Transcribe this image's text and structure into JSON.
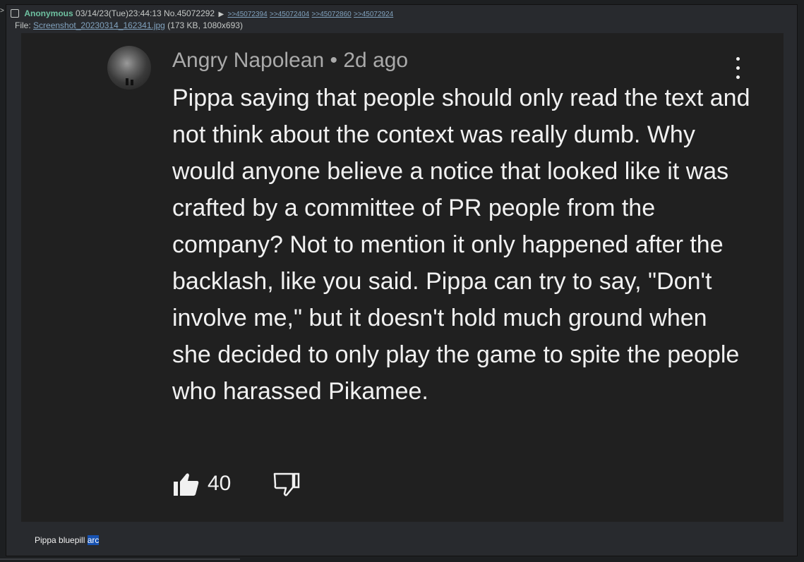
{
  "post": {
    "name": "Anonymous",
    "datetime": "03/14/23(Tue)23:44:13",
    "number": "No.45072292",
    "backlinks": [
      ">>45072394",
      ">>45072404",
      ">>45072860",
      ">>45072924"
    ],
    "file_label": "File:",
    "file_name": "Screenshot_20230314_162341.jpg",
    "file_meta": "(173 KB, 1080x693)",
    "comment_text": "Pippa bluepill",
    "comment_highlight": "arc"
  },
  "screenshot": {
    "author": "Angry Napolean",
    "separator": "•",
    "time_ago": "2d ago",
    "body": "Pippa saying that people should only read the text and not think about the context was really dumb. Why would anyone believe a notice that looked like it was crafted by a committee of PR people from the company? Not to mention it only happened after the backlash, like you said. Pippa can try to say, \"Don't involve me,\" but it doesn't hold much ground when she decided to only play the game to spite the people who harassed Pikamee.",
    "like_count": "40"
  },
  "icons": {
    "checkbox": "checkbox-icon",
    "menu": "kebab-menu-icon",
    "like": "thumbs-up-icon",
    "dislike": "thumbs-down-icon",
    "expand": "triangle-icon"
  },
  "colors": {
    "background": "#1d1f21",
    "post_background": "#282a2e",
    "name": "#6ec1a1",
    "link": "#81a2be",
    "screenshot_background": "#202020",
    "highlight": "#1752b2"
  }
}
